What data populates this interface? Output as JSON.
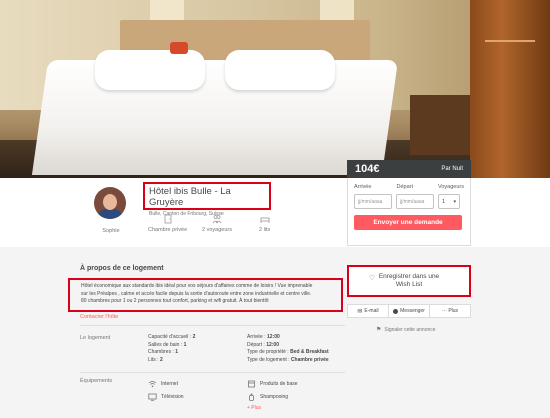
{
  "booking": {
    "price": "104€",
    "per_night": "Par Nuit",
    "arrival_label": "Arrivée",
    "departure_label": "Départ",
    "guests_label": "Voyageurs",
    "arrival_placeholder": "jj/mm/aaaa",
    "departure_placeholder": "jj/mm/aaaa",
    "guests_value": "1",
    "submit_label": "Envoyer une demande"
  },
  "host": {
    "name": "Sophie"
  },
  "listing": {
    "title": "Hôtel ibis Bulle - La Gruyère",
    "location": "Bulle, Canton de Fribourg, Suisse"
  },
  "amenities": [
    {
      "icon": "door-icon",
      "label": "Chambre privée"
    },
    {
      "icon": "people-icon",
      "label": "2 voyageurs"
    },
    {
      "icon": "bed-icon",
      "label": "2 lits"
    }
  ],
  "about": {
    "title": "À propos de ce logement",
    "description_lines": [
      "Hôtel économique aux standards ibis idéal pour vos séjours d'affaires comme de loisirs ! Vue imprenable",
      "sur les Préalpes , calme et accès facile depuis la sortie d'autoroute entre zone industrielle et centre ville.",
      "80 chambres pour 1 ou 2 personnes tout confort, parking et wifi gratuit. À tout bientôt"
    ],
    "contact_label": "Contacter l'hôte"
  },
  "logement": {
    "label": "Le logement",
    "left": [
      {
        "k": "Capacité d'accueil : ",
        "v": "2"
      },
      {
        "k": "Salles de bain : ",
        "v": "1"
      },
      {
        "k": "Chambres : ",
        "v": "1"
      },
      {
        "k": "Lits : ",
        "v": "2"
      }
    ],
    "right": [
      {
        "k": "Arrivée : ",
        "v": "12:00"
      },
      {
        "k": "Départ : ",
        "v": "12:00"
      },
      {
        "k": "Type de propriété : ",
        "v": "Bed & Breakfast"
      },
      {
        "k": "Type de logement : ",
        "v": "Chambre privée"
      }
    ]
  },
  "equipements": {
    "label": "Équipements",
    "items": [
      {
        "icon": "wifi-icon",
        "label": "Internet"
      },
      {
        "icon": "products-icon",
        "label": "Produits de base"
      },
      {
        "icon": "tv-icon",
        "label": "Télévision"
      },
      {
        "icon": "shampoo-icon",
        "label": "Shampooing"
      }
    ],
    "more_label": "+ Plus"
  },
  "sidebar": {
    "wishlist_line1": "Enregistrer dans une",
    "wishlist_line2": "Wish List",
    "share_email": "E-mail",
    "share_messenger": "Messenger",
    "share_more": "··· Plus",
    "report": "Signaler cette annonce"
  },
  "colors": {
    "accent": "#ff5a5f",
    "highlight": "#d9001b",
    "price_bar": "#3c3f40"
  }
}
